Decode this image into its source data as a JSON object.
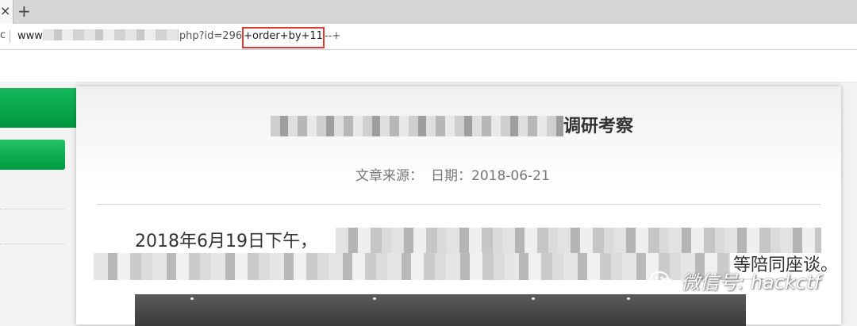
{
  "browser": {
    "tab_close_glyph": "×",
    "new_tab_glyph": "+",
    "address_icon": "c",
    "url": {
      "prefix": "www",
      "middle": "php?id=296",
      "injection": "+order+by+11",
      "suffix": "--+"
    }
  },
  "article": {
    "title_visible": "调研考察",
    "meta_source": "文章来源：",
    "meta_date": "日期：2018-06-21",
    "para1_start": "2018年6月19日下午，",
    "para2_end": "等陪同座谈。"
  },
  "watermark": {
    "text": "微信号: hackctf",
    "icon": "wechat-icon"
  },
  "colors": {
    "accent_green": "#00953f",
    "highlight_red": "#e53935"
  }
}
